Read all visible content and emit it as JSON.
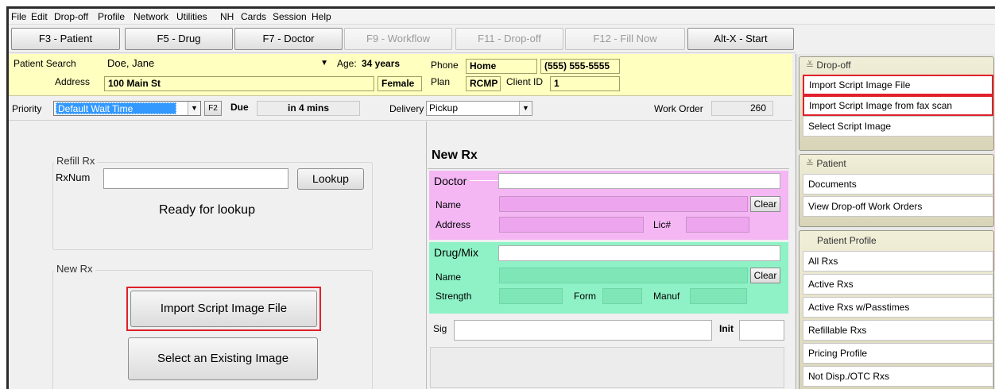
{
  "menu": [
    "File",
    "Edit",
    "Drop-off",
    "Profile",
    "Network",
    "Utilities",
    "NH",
    "Cards",
    "Session",
    "Help"
  ],
  "toolbar": {
    "patient": "F3 - Patient",
    "drug": "F5 - Drug",
    "doctor": "F7 - Doctor",
    "workflow": "F9 - Workflow",
    "dropoff": "F11 - Drop-off",
    "fillnow": "F12 - Fill Now",
    "start": "Alt-X - Start"
  },
  "patient": {
    "search_label": "Patient Search",
    "search_value": "Doe, Jane",
    "age_label": "Age:",
    "age_value": "34 years",
    "phone_label": "Phone",
    "phone_type": "Home",
    "phone_number": "(555) 555-5555",
    "address_label": "Address",
    "address_value": "100 Main St",
    "gender": "Female",
    "plan_label": "Plan",
    "plan_value": "RCMP",
    "client_id_label": "Client ID",
    "client_id_value": "1"
  },
  "priority": {
    "label": "Priority",
    "value": "Default Wait Time",
    "f2": "F2",
    "due_label": "Due",
    "due_value": "in 4 mins",
    "delivery_label": "Delivery",
    "delivery_value": "Pickup",
    "work_order_label": "Work Order",
    "work_order_value": "260"
  },
  "refill": {
    "group_label": "Refill Rx",
    "rxnum_label": "RxNum",
    "lookup": "Lookup",
    "status": "Ready for lookup"
  },
  "newrx_left": {
    "group_label": "New Rx",
    "import_button": "Import Script Image File",
    "select_button": "Select an Existing Image"
  },
  "newrx": {
    "title": "New Rx",
    "doctor_label": "Doctor",
    "name_label": "Name",
    "clear": "Clear",
    "address_label": "Address",
    "lic_label": "Lic#",
    "drug_label": "Drug/Mix",
    "drug_name_label": "Name",
    "strength_label": "Strength",
    "form_label": "Form",
    "manuf_label": "Manuf",
    "sig_label": "Sig",
    "init_label": "Init"
  },
  "sidebar": {
    "dropoff_header": "Drop-off",
    "dropoff_items": [
      "Import Script Image File",
      "Import Script Image from fax scan",
      "Select Script Image"
    ],
    "patient_header": "Patient",
    "patient_items": [
      "Documents",
      "View Drop-off Work Orders"
    ],
    "profile_header": "Patient Profile",
    "profile_items": [
      "All Rxs",
      "Active Rxs",
      "Active Rxs w/Passtimes",
      "Refillable Rxs",
      "Pricing Profile",
      "Not Disp./OTC Rxs"
    ]
  },
  "colors": {
    "highlight_red": "#e0202a",
    "patient_bar": "#ffffc0",
    "doctor_pink": "#f4b7f4",
    "drug_green": "#8ef2c6",
    "selection_blue": "#3399ff"
  }
}
